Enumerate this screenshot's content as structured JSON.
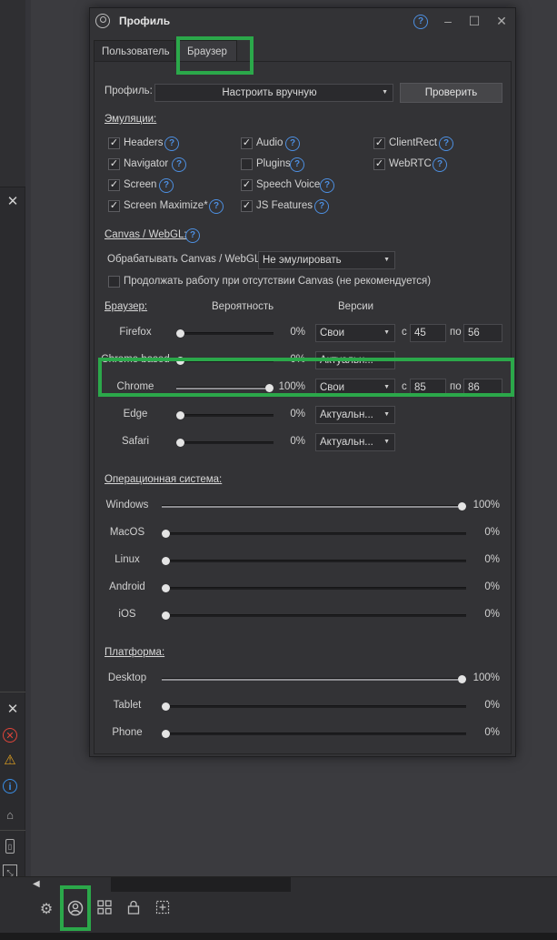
{
  "window": {
    "title": "Профиль"
  },
  "tabs": [
    {
      "label": "Пользователь",
      "active": false
    },
    {
      "label": "Браузер",
      "active": true
    }
  ],
  "profile": {
    "label": "Профиль:",
    "combo_value": "Настроить вручную",
    "check_button": "Проверить"
  },
  "emulations": {
    "title": "Эмуляции:",
    "items": [
      {
        "label": "Headers",
        "checked": true,
        "help": true
      },
      {
        "label": "Audio",
        "checked": true,
        "help": true
      },
      {
        "label": "ClientRect",
        "checked": true,
        "help": true
      },
      {
        "label": "Navigator",
        "checked": true,
        "help": true
      },
      {
        "label": "Plugins",
        "checked": false,
        "help": true
      },
      {
        "label": "WebRTC",
        "checked": true,
        "help": true
      },
      {
        "label": "Screen",
        "checked": true,
        "help": true
      },
      {
        "label": "Speech Voice",
        "checked": true,
        "help": true
      },
      {
        "label": "Screen Maximize*",
        "checked": true,
        "help": true
      },
      {
        "label": "JS Features",
        "checked": true,
        "help": true
      }
    ]
  },
  "canvas": {
    "title": "Canvas / WebGL:",
    "process_label": "Обрабатывать Canvas / WebGL",
    "process_value": "Не эмулировать",
    "continue_label": "Продолжать работу при отсутствии Canvas (не рекомендуется)",
    "continue_checked": false
  },
  "browser": {
    "title": "Браузер:",
    "col_probability": "Вероятность",
    "col_versions": "Версии",
    "from_label": "с",
    "to_label": "по",
    "rows": [
      {
        "name": "Firefox",
        "percent": "0%",
        "level": 0.0,
        "version": "Свои",
        "from": "45",
        "to": "56"
      },
      {
        "name": "Chrome based",
        "percent": "0%",
        "level": 0.0,
        "version": "Актуальн..."
      },
      {
        "name": "Chrome",
        "percent": "100%",
        "level": 1.0,
        "version": "Свои",
        "from": "85",
        "to": "86"
      },
      {
        "name": "Edge",
        "percent": "0%",
        "level": 0.0,
        "version": "Актуальн..."
      },
      {
        "name": "Safari",
        "percent": "0%",
        "level": 0.0,
        "version": "Актуальн..."
      }
    ]
  },
  "os": {
    "title": "Операционная система:",
    "rows": [
      {
        "name": "Windows",
        "percent": "100%",
        "level": 1.0
      },
      {
        "name": "MacOS",
        "percent": "0%",
        "level": 0.0
      },
      {
        "name": "Linux",
        "percent": "0%",
        "level": 0.0
      },
      {
        "name": "Android",
        "percent": "0%",
        "level": 0.0
      },
      {
        "name": "iOS",
        "percent": "0%",
        "level": 0.0
      }
    ]
  },
  "platform": {
    "title": "Платформа:",
    "rows": [
      {
        "name": "Desktop",
        "percent": "100%",
        "level": 1.0
      },
      {
        "name": "Tablet",
        "percent": "0%",
        "level": 0.0
      },
      {
        "name": "Phone",
        "percent": "0%",
        "level": 0.0
      }
    ]
  },
  "icons": {
    "help": "?",
    "close": "✕",
    "minimize": "–",
    "maximize": "☐",
    "check": "✓",
    "caret": "▼"
  },
  "colors": {
    "highlight": "#2ba84a",
    "help_blue": "#4d8fe0",
    "error": "#e0453a",
    "warning": "#e0a020",
    "info": "#3a8ee6"
  }
}
